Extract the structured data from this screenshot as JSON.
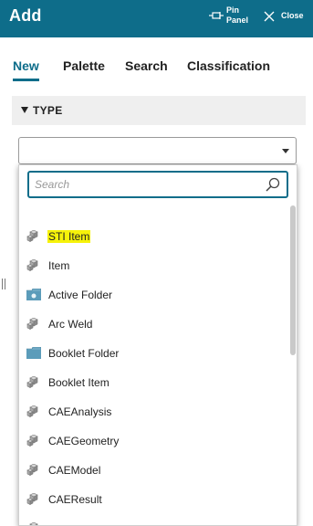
{
  "header": {
    "title": "Add",
    "pin_label": "Pin Panel",
    "close_label": "Close"
  },
  "tabs": [
    {
      "label": "New",
      "active": true
    },
    {
      "label": "Palette",
      "active": false
    },
    {
      "label": "Search",
      "active": false
    },
    {
      "label": "Classification",
      "active": false
    }
  ],
  "type_section": {
    "label": "TYPE",
    "selected_value": ""
  },
  "dropdown": {
    "search_placeholder": "Search",
    "search_value": "",
    "items": [
      {
        "label": "STI Item",
        "icon": "item-cube-icon",
        "highlighted": true
      },
      {
        "label": "Item",
        "icon": "item-cube-icon",
        "highlighted": false
      },
      {
        "label": "Active Folder",
        "icon": "active-folder-icon",
        "highlighted": false
      },
      {
        "label": "Arc Weld",
        "icon": "item-cube-icon",
        "highlighted": false
      },
      {
        "label": "Booklet Folder",
        "icon": "folder-icon",
        "highlighted": false
      },
      {
        "label": "Booklet Item",
        "icon": "item-cube-icon",
        "highlighted": false
      },
      {
        "label": "CAEAnalysis",
        "icon": "item-cube-icon",
        "highlighted": false
      },
      {
        "label": "CAEGeometry",
        "icon": "item-cube-icon",
        "highlighted": false
      },
      {
        "label": "CAEModel",
        "icon": "item-cube-icon",
        "highlighted": false
      },
      {
        "label": "CAEResult",
        "icon": "item-cube-icon",
        "highlighted": false
      }
    ]
  },
  "colors": {
    "accent": "#0e6d8a",
    "highlight": "#f6f20a",
    "section_bg": "#efefef"
  }
}
